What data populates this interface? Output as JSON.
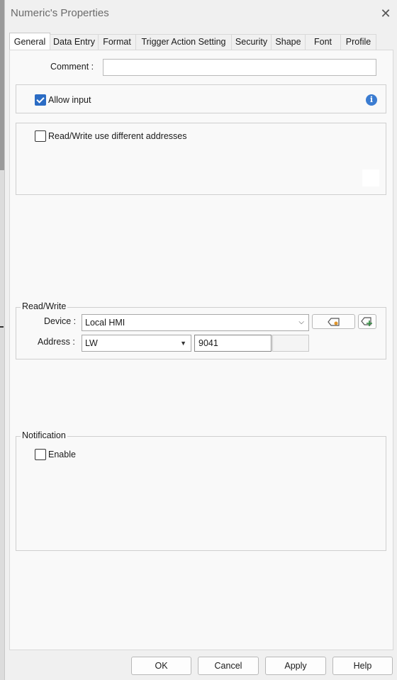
{
  "window": {
    "title": "Numeric's Properties"
  },
  "tabs": [
    {
      "label": "General"
    },
    {
      "label": "Data Entry"
    },
    {
      "label": "Format"
    },
    {
      "label": "Trigger Action Setting"
    },
    {
      "label": "Security"
    },
    {
      "label": "Shape"
    },
    {
      "label": "Font"
    },
    {
      "label": "Profile"
    }
  ],
  "active_tab": "General",
  "comment": {
    "label": "Comment :",
    "value": ""
  },
  "allow_input": {
    "label": "Allow input",
    "checked": true,
    "info_icon": "info-icon"
  },
  "rw_diff": {
    "label": "Read/Write use different addresses",
    "checked": false
  },
  "read_write": {
    "legend": "Read/Write",
    "device_label": "Device :",
    "device_value": "Local HMI",
    "address_label": "Address :",
    "address_type": "LW",
    "address_value": "9041",
    "tag_button_icon": "tag-icon",
    "add_tag_button_icon": "tag-add-icon"
  },
  "notification": {
    "legend": "Notification",
    "enable_label": "Enable",
    "checked": false
  },
  "footer": {
    "ok": "OK",
    "cancel": "Cancel",
    "apply": "Apply",
    "help": "Help"
  },
  "colors": {
    "accent": "#2b6cc4",
    "info": "#3b7cd1",
    "tag_dot": "#e0952b",
    "add_green": "#2e8b3d"
  }
}
